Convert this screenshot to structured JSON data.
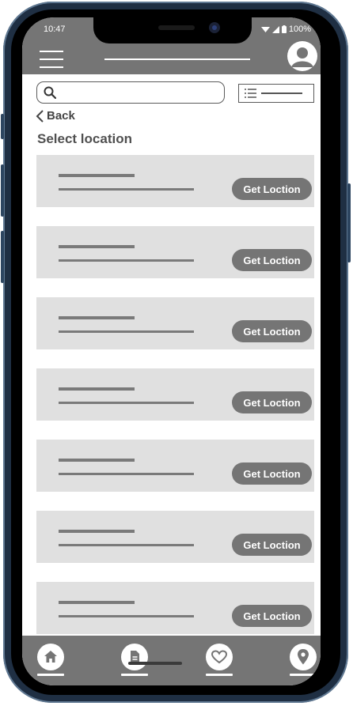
{
  "status_bar": {
    "time": "10:47",
    "battery": "100%"
  },
  "header": {
    "menu_icon": "hamburger-icon",
    "profile_icon": "user-avatar-icon"
  },
  "search": {
    "icon": "search-icon",
    "placeholder": ""
  },
  "filter": {
    "icon": "list-icon"
  },
  "nav": {
    "back_label": "Back"
  },
  "page": {
    "title": "Select location"
  },
  "locations": [
    {
      "button_label": "Get Loction"
    },
    {
      "button_label": "Get Loction"
    },
    {
      "button_label": "Get Loction"
    },
    {
      "button_label": "Get Loction"
    },
    {
      "button_label": "Get Loction"
    },
    {
      "button_label": "Get Loction"
    },
    {
      "button_label": "Get Loction"
    }
  ],
  "bottom_nav": {
    "items": [
      {
        "icon": "home-icon"
      },
      {
        "icon": "document-icon"
      },
      {
        "icon": "heart-icon"
      },
      {
        "icon": "location-pin-icon"
      }
    ]
  },
  "colors": {
    "bar": "#757575",
    "card": "#e0e0e0",
    "button": "#757575",
    "frame": "#1f2f43"
  }
}
